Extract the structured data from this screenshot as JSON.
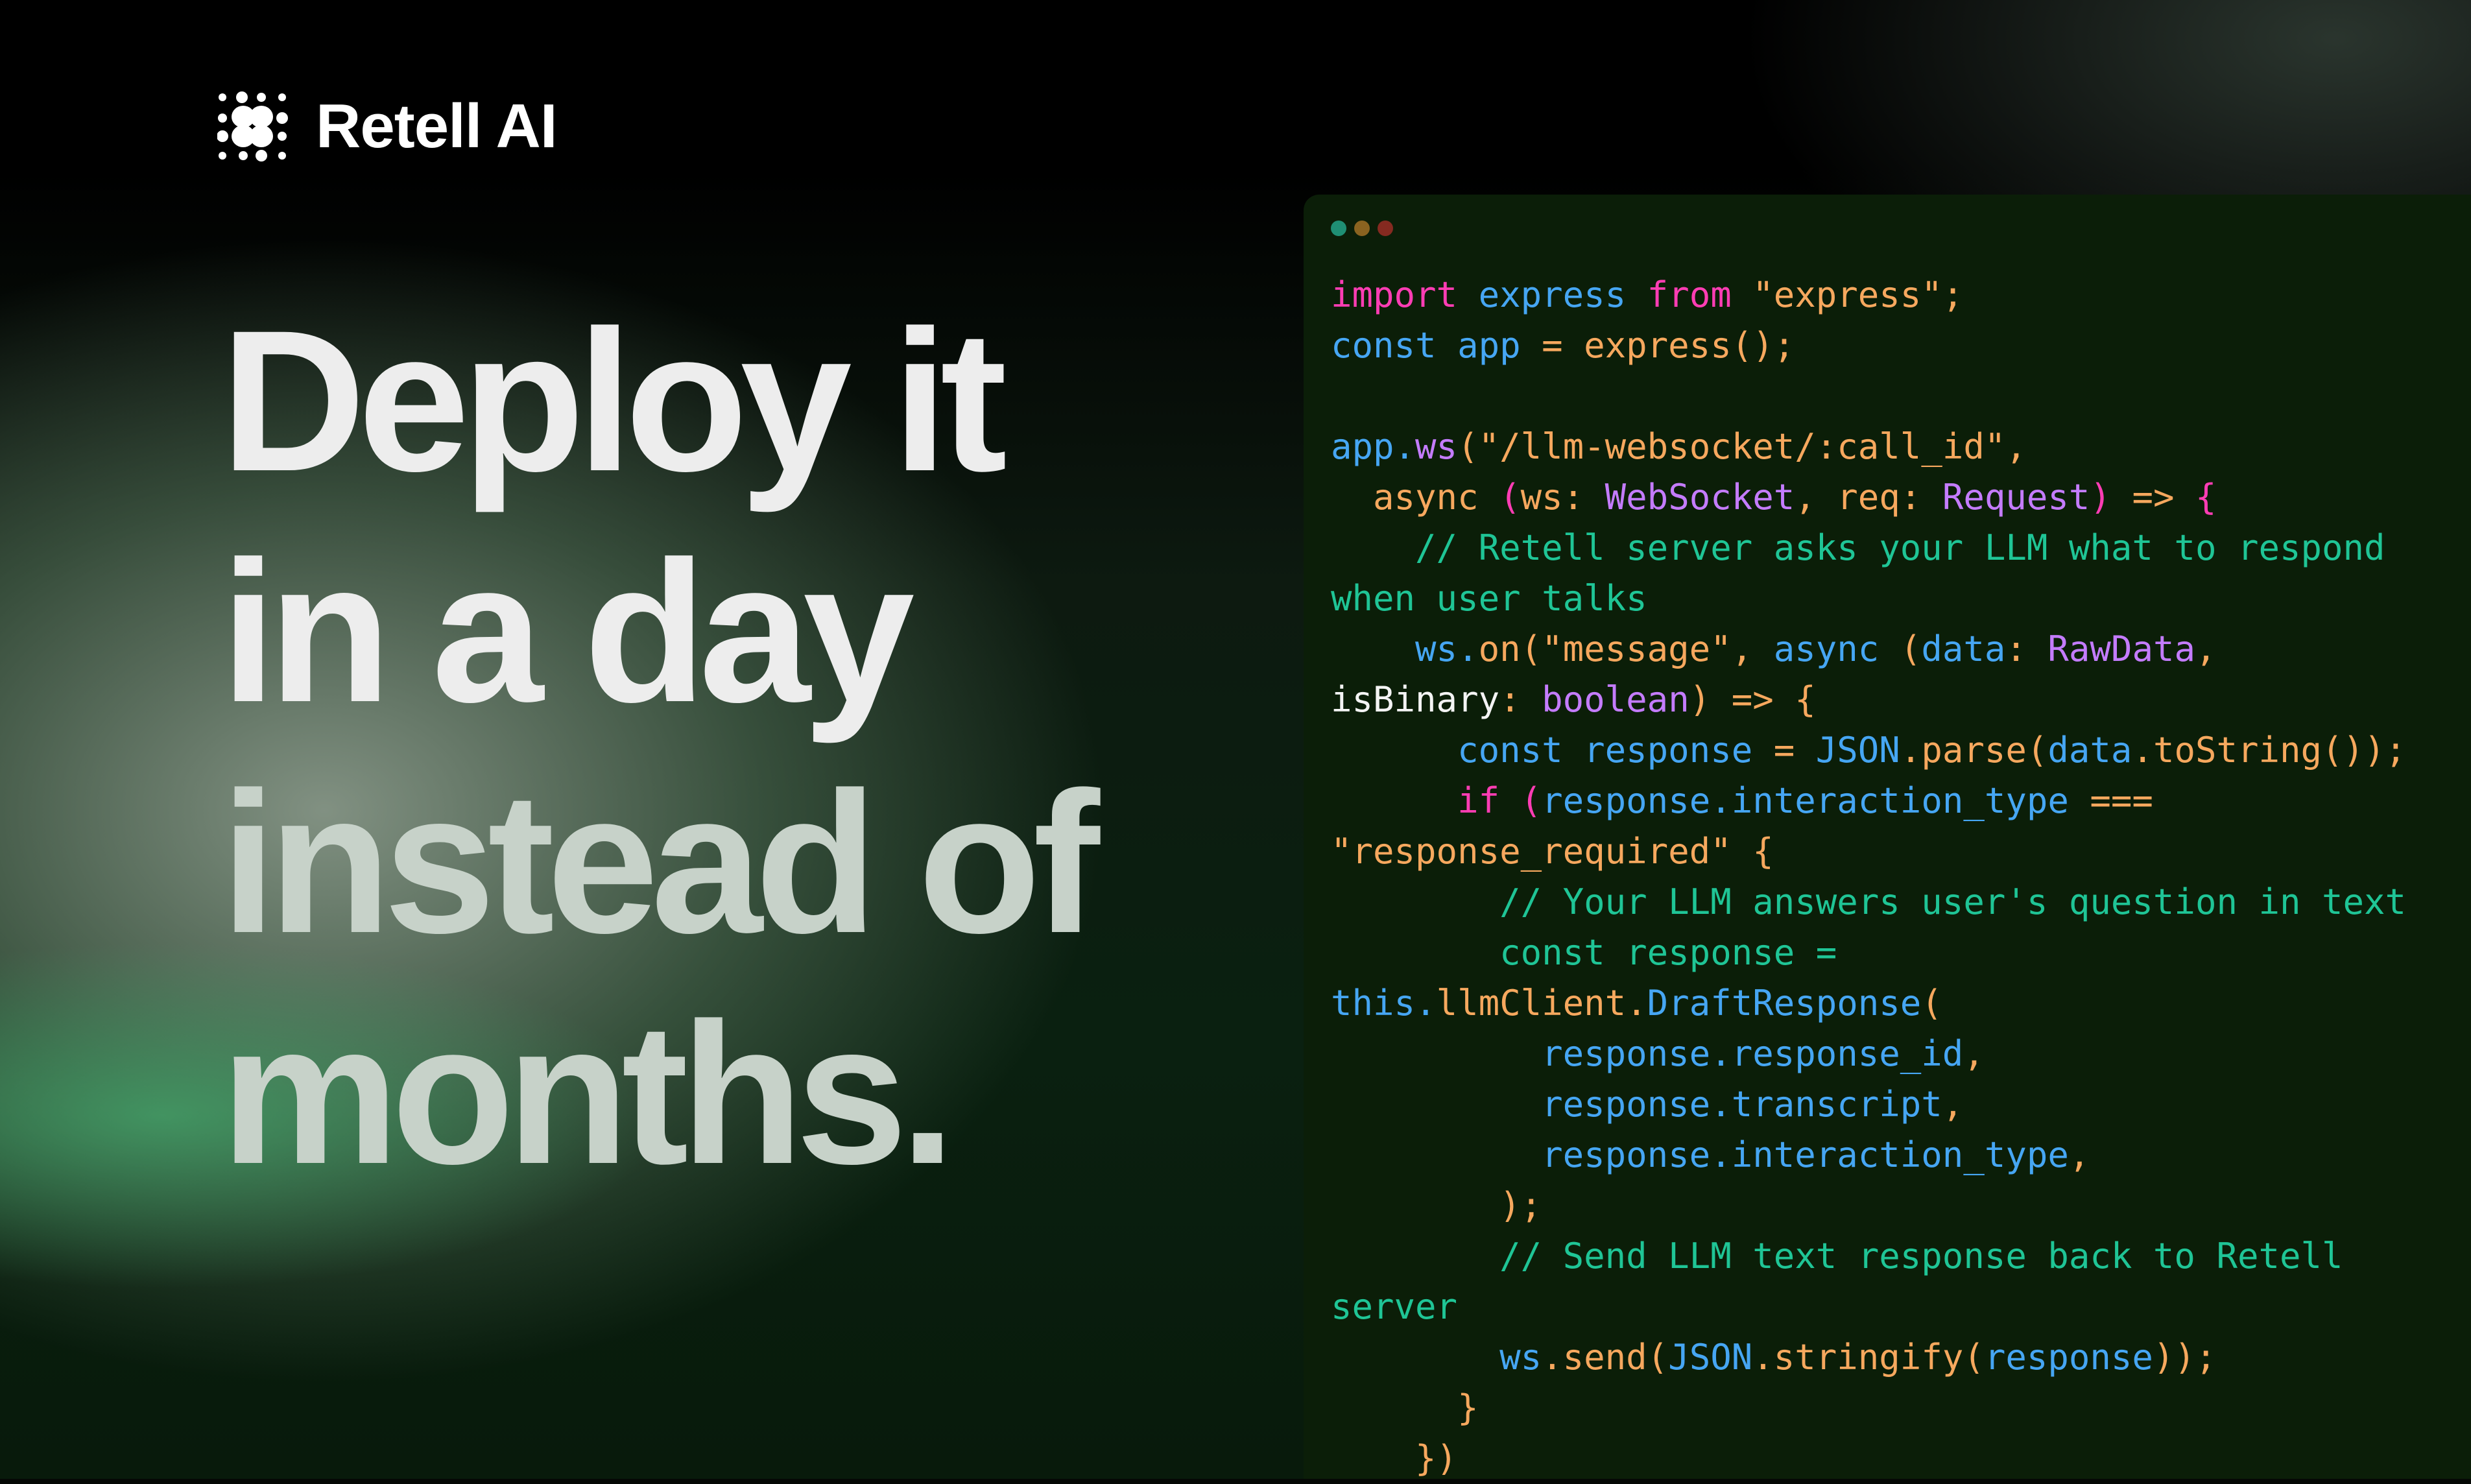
{
  "brand": {
    "name": "Retell AI",
    "logo_icon": "retell-dot-grid-logo"
  },
  "headline": {
    "lines": [
      "Deploy it",
      "in a day",
      "instead of",
      "months."
    ]
  },
  "code_window": {
    "dots": [
      {
        "name": "green-dot",
        "color": "#1f8f74"
      },
      {
        "name": "yellow-dot",
        "color": "#8a6320"
      },
      {
        "name": "red-dot",
        "color": "#852a20"
      }
    ],
    "colors": {
      "pink": "#ff3db4",
      "blue": "#46a6f3",
      "orange": "#f6a85e",
      "purple": "#c47cff",
      "teal": "#1fc596",
      "white": "#f4f4f4"
    },
    "lines": [
      [
        [
          "pink",
          "import "
        ],
        [
          "blue",
          "express "
        ],
        [
          "pink",
          "from "
        ],
        [
          "orange",
          "\"express\";"
        ]
      ],
      [
        [
          "blue",
          "const app "
        ],
        [
          "orange",
          "= express();"
        ]
      ],
      [],
      [
        [
          "blue",
          "app."
        ],
        [
          "purple",
          "ws"
        ],
        [
          "orange",
          "(\"/llm-websocket/:call_id\","
        ]
      ],
      [
        [
          "orange",
          "  async "
        ],
        [
          "pink",
          "("
        ],
        [
          "orange",
          "ws: "
        ],
        [
          "purple",
          "WebSocket"
        ],
        [
          "orange",
          ", req: "
        ],
        [
          "purple",
          "Request"
        ],
        [
          "pink",
          ")"
        ],
        [
          "orange",
          " => "
        ],
        [
          "pink",
          "{"
        ]
      ],
      [
        [
          "teal",
          "    // Retell server asks your LLM what to respond"
        ]
      ],
      [
        [
          "teal",
          "when user talks"
        ]
      ],
      [
        [
          "blue",
          "    ws."
        ],
        [
          "orange",
          "on(\"message\", "
        ],
        [
          "blue",
          "async "
        ],
        [
          "orange",
          "("
        ],
        [
          "blue",
          "data"
        ],
        [
          "orange",
          ": "
        ],
        [
          "purple",
          "RawData"
        ],
        [
          "orange",
          ","
        ]
      ],
      [
        [
          "white",
          "isBinary"
        ],
        [
          "orange",
          ": "
        ],
        [
          "purple",
          "boolean"
        ],
        [
          "orange",
          ") => {"
        ]
      ],
      [
        [
          "blue",
          "      const response "
        ],
        [
          "orange",
          "= "
        ],
        [
          "blue",
          "JSON"
        ],
        [
          "orange",
          ".parse("
        ],
        [
          "blue",
          "data"
        ],
        [
          "orange",
          ".toString());"
        ]
      ],
      [
        [
          "pink",
          "      if "
        ],
        [
          "pink",
          "("
        ],
        [
          "blue",
          "response.interaction_type "
        ],
        [
          "orange",
          "==="
        ]
      ],
      [
        [
          "orange",
          "\"response_required\" {"
        ]
      ],
      [
        [
          "teal",
          "        // Your LLM answers user's question in text"
        ]
      ],
      [
        [
          "teal",
          "        const response ="
        ]
      ],
      [
        [
          "blue",
          "this."
        ],
        [
          "orange",
          "llmClient."
        ],
        [
          "blue",
          "DraftResponse"
        ],
        [
          "orange",
          "("
        ]
      ],
      [
        [
          "blue",
          "          response.response_id"
        ],
        [
          "orange",
          ","
        ]
      ],
      [
        [
          "blue",
          "          response.transcript"
        ],
        [
          "orange",
          ","
        ]
      ],
      [
        [
          "blue",
          "          response.interaction_type"
        ],
        [
          "orange",
          ","
        ]
      ],
      [
        [
          "orange",
          "        );"
        ]
      ],
      [
        [
          "teal",
          "        // Send LLM text response back to Retell"
        ]
      ],
      [
        [
          "teal",
          "server"
        ]
      ],
      [
        [
          "blue",
          "        ws"
        ],
        [
          "orange",
          ".send("
        ],
        [
          "blue",
          "JSON"
        ],
        [
          "orange",
          ".stringify("
        ],
        [
          "blue",
          "response"
        ],
        [
          "orange",
          "));"
        ]
      ],
      [
        [
          "orange",
          "      }"
        ]
      ],
      [
        [
          "orange",
          "    })"
        ]
      ]
    ]
  }
}
